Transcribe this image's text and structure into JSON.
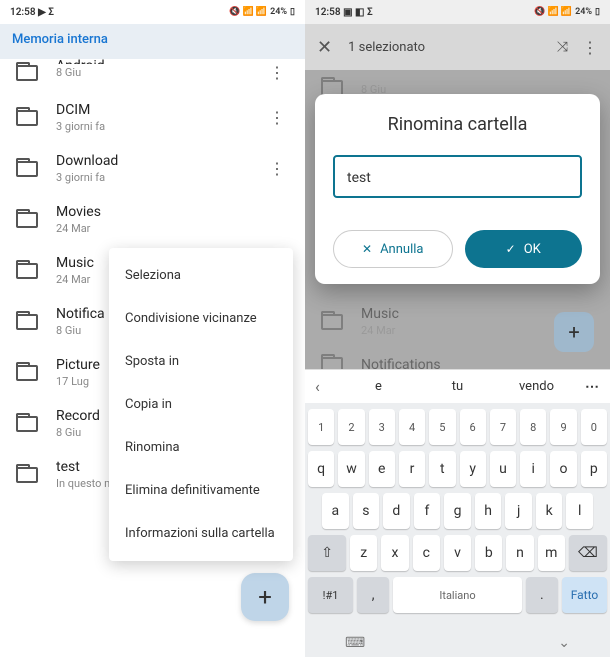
{
  "left": {
    "statusbar": {
      "time": "12:58",
      "battery": "24%"
    },
    "header_title": "Memoria interna",
    "folders": [
      {
        "name": "Android",
        "date": "8 Giu"
      },
      {
        "name": "DCIM",
        "date": "3 giorni fa"
      },
      {
        "name": "Download",
        "date": "3 giorni fa"
      },
      {
        "name": "Movies",
        "date": "24 Mar"
      },
      {
        "name": "Music",
        "date": "24 Mar"
      },
      {
        "name": "Notifications",
        "date": "8 Giu"
      },
      {
        "name": "Pictures",
        "date": "17 Lug"
      },
      {
        "name": "Recordings",
        "date": "8 Giu"
      },
      {
        "name": "test",
        "date": "In questo momento"
      }
    ],
    "context_menu": [
      "Seleziona",
      "Condivisione vicinanze",
      "Sposta in",
      "Copia in",
      "Rinomina",
      "Elimina definitivamente",
      "Informazioni sulla cartella"
    ],
    "fab": "+"
  },
  "right": {
    "statusbar": {
      "time": "12:58",
      "battery": "24%"
    },
    "selection_label": "1 selezionato",
    "folders": [
      {
        "name": "",
        "date": "8 Giu"
      },
      {
        "name": "Music",
        "date": "24 Mar"
      },
      {
        "name": "Notifications",
        "date": ""
      }
    ],
    "dialog": {
      "title": "Rinomina cartella",
      "value": "test",
      "cancel": "Annulla",
      "ok": "OK"
    },
    "suggestions": [
      "e",
      "tu",
      "vendo"
    ],
    "keyboard": {
      "row1": [
        "1",
        "2",
        "3",
        "4",
        "5",
        "6",
        "7",
        "8",
        "9",
        "0"
      ],
      "row2": [
        "q",
        "w",
        "e",
        "r",
        "t",
        "y",
        "u",
        "i",
        "o",
        "p"
      ],
      "row3": [
        "a",
        "s",
        "d",
        "f",
        "g",
        "h",
        "j",
        "k",
        "l"
      ],
      "row4": [
        "⇧",
        "z",
        "x",
        "c",
        "v",
        "b",
        "n",
        "m",
        "⌫"
      ],
      "row5_sym": "!#1",
      "row5_comma": ",",
      "row5_space": "Italiano",
      "row5_period": ".",
      "row5_done": "Fatto"
    },
    "fab": "+"
  }
}
